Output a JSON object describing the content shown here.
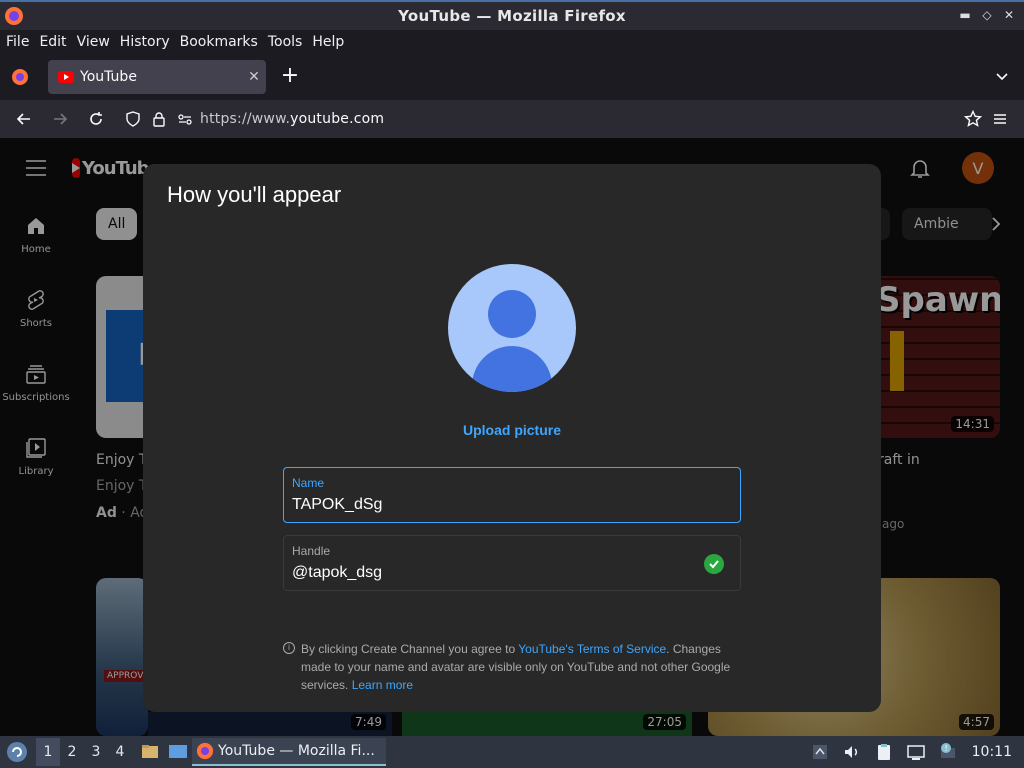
{
  "window": {
    "title": "YouTube — Mozilla Firefox"
  },
  "menu": [
    "File",
    "Edit",
    "View",
    "History",
    "Bookmarks",
    "Tools",
    "Help"
  ],
  "tab": {
    "label": "YouTube"
  },
  "address": {
    "url_prefix": "https://www.",
    "url_domain": "youtube.com"
  },
  "youtube": {
    "logo_text": "YouTube",
    "avatar_letter": "V",
    "sidebar": [
      {
        "label": "Home"
      },
      {
        "label": "Shorts"
      },
      {
        "label": "Subscriptions"
      },
      {
        "label": "Library"
      }
    ],
    "chips": {
      "first": "All",
      "ambient": "Ambie"
    },
    "videos": {
      "left_title": "Enjoy Th",
      "left_channel": "Enjoy Th",
      "left_ad": "Ad",
      "left_ad_rest": " · Ad",
      "right_thumb_text": "Spawn",
      "right_duration": "14:31",
      "right_title": "raft in",
      "right_meta": "ago",
      "bottom_thumb_badge": "APPROVE",
      "bottom_durations": [
        "7:49",
        "27:05",
        "4:57"
      ]
    }
  },
  "dialog": {
    "title": "How you'll appear",
    "upload_label": "Upload picture",
    "name_label": "Name",
    "name_value": "TAPOK_dSg",
    "handle_label": "Handle",
    "handle_value": "@tapok_dsg",
    "terms_part1": "By clicking Create Channel you agree to ",
    "terms_link": "YouTube's Terms of Service",
    "terms_part2": ". Changes made to your name and avatar are visible only on YouTube and not other Google services. ",
    "learn_more": "Learn more"
  },
  "taskbar": {
    "workspaces": [
      "1",
      "2",
      "3",
      "4"
    ],
    "app_label": "YouTube — Mozilla Fi...",
    "clock": "10:11"
  },
  "colors": {
    "accent_blue": "#3ea6ff",
    "youtube_red": "#ff0000",
    "avatar_orange": "#c2500f",
    "check_green": "#2ba640"
  }
}
